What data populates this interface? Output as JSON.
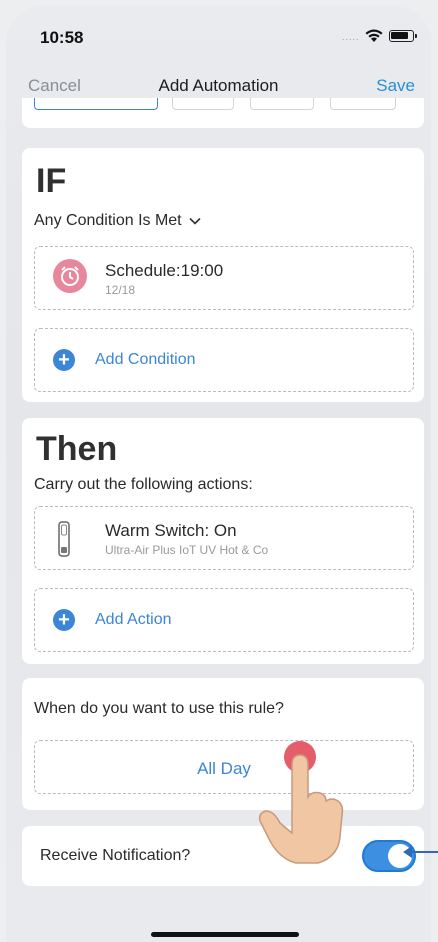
{
  "status_bar": {
    "time": "10:58",
    "signal": "....."
  },
  "nav": {
    "cancel": "Cancel",
    "title": "Add Automation",
    "save": "Save"
  },
  "if_section": {
    "title": "IF",
    "condition_mode": "Any Condition Is Met",
    "condition": {
      "title": "Schedule:19:00",
      "date": "12/18",
      "icon": "alarm-clock-icon"
    },
    "add_label": "Add Condition"
  },
  "then_section": {
    "title": "Then",
    "subtitle": "Carry out the following actions:",
    "action": {
      "title": "Warm Switch: On",
      "device": "Ultra-Air Plus IoT UV Hot & Co",
      "icon": "device-icon"
    },
    "add_label": "Add Action"
  },
  "when_section": {
    "question": "When do you want to use this rule?",
    "value": "All Day"
  },
  "notification": {
    "label": "Receive Notification?",
    "enabled": true
  },
  "colors": {
    "accent": "#3b86d6",
    "alarm": "#e7879b",
    "save": "#2b8fd8"
  }
}
